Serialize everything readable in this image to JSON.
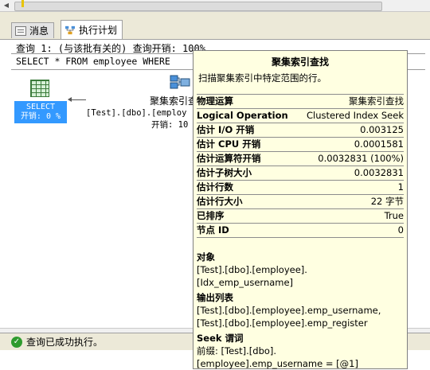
{
  "tabs": {
    "messages_label": "消息",
    "plan_label": "执行计划"
  },
  "query": {
    "header": "查询 1: (与该批有关的) 查询开销: 100%",
    "sql": "SELECT * FROM employee WHERE"
  },
  "select_node": {
    "label": "SELECT",
    "cost": "开销: 0 %"
  },
  "clustered_node": {
    "title": "聚集索引查",
    "object": "[Test].[dbo].[employ",
    "cost": "开销: 10"
  },
  "tooltip": {
    "title": "聚集索引查找",
    "description": "扫描聚集索引中特定范围的行。",
    "rows": [
      {
        "key": "物理运算",
        "value": "聚集索引查找"
      },
      {
        "key": "Logical Operation",
        "value": "Clustered Index Seek"
      },
      {
        "key": "估计 I/O 开销",
        "value": "0.003125"
      },
      {
        "key": "估计 CPU 开销",
        "value": "0.0001581"
      },
      {
        "key": "估计运算符开销",
        "value": "0.0032831 (100%)"
      },
      {
        "key": "估计子树大小",
        "value": "0.0032831"
      },
      {
        "key": "估计行数",
        "value": "1"
      },
      {
        "key": "估计行大小",
        "value": "22 字节"
      },
      {
        "key": "已排序",
        "value": "True"
      },
      {
        "key": "节点 ID",
        "value": "0"
      }
    ],
    "object_heading": "对象",
    "object_lines": [
      "[Test].[dbo].[employee].",
      "[Idx_emp_username]"
    ],
    "output_heading": "输出列表",
    "output_lines": [
      "[Test].[dbo].[employee].emp_username,",
      "[Test].[dbo].[employee].emp_register"
    ],
    "seek_heading": "Seek 谓词",
    "seek_lines": [
      "前缀: [Test].[dbo].",
      "[employee].emp_username = [@1]"
    ]
  },
  "status": {
    "text": "查询已成功执行。"
  }
}
